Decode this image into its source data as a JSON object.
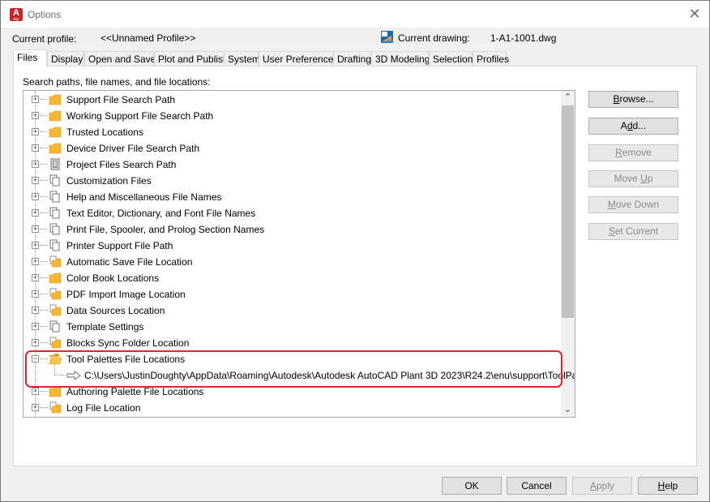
{
  "window": {
    "title": "Options",
    "app_icon_letter": "A",
    "app_icon_sub": "PID",
    "close_glyph": "✕"
  },
  "profile": {
    "current_profile_label": "Current profile:",
    "current_profile_value": "<<Unnamed Profile>>",
    "current_drawing_label": "Current drawing:",
    "current_drawing_value": "1-A1-1001.dwg"
  },
  "tabs": [
    {
      "label": "Files",
      "active": true
    },
    {
      "label": "Display"
    },
    {
      "label": "Open and Save"
    },
    {
      "label": "Plot and Publish"
    },
    {
      "label": "System"
    },
    {
      "label": "User Preferences"
    },
    {
      "label": "Drafting"
    },
    {
      "label": "3D Modeling"
    },
    {
      "label": "Selection"
    },
    {
      "label": "Profiles"
    }
  ],
  "files": {
    "search_label": "Search paths, file names, and file locations:",
    "tree": [
      {
        "label": "Support File Search Path",
        "icon": "folder-icon"
      },
      {
        "label": "Working Support File Search Path",
        "icon": "folder-icon"
      },
      {
        "label": "Trusted Locations",
        "icon": "folder-icon"
      },
      {
        "label": "Device Driver File Search Path",
        "icon": "folder-icon"
      },
      {
        "label": "Project Files Search Path",
        "icon": "project-file-icon"
      },
      {
        "label": "Customization Files",
        "icon": "files-icon"
      },
      {
        "label": "Help and Miscellaneous File Names",
        "icon": "files-icon"
      },
      {
        "label": "Text Editor, Dictionary, and Font File Names",
        "icon": "files-icon"
      },
      {
        "label": "Print File, Spooler, and Prolog Section Names",
        "icon": "files-icon"
      },
      {
        "label": "Printer Support File Path",
        "icon": "files-icon"
      },
      {
        "label": "Automatic Save File Location",
        "icon": "folder-file-icon"
      },
      {
        "label": "Color Book Locations",
        "icon": "folder-icon"
      },
      {
        "label": "PDF Import Image Location",
        "icon": "folder-file-icon"
      },
      {
        "label": "Data Sources Location",
        "icon": "folder-file-icon"
      },
      {
        "label": "Template Settings",
        "icon": "files-icon"
      },
      {
        "label": "Blocks Sync Folder Location",
        "icon": "folder-file-icon"
      },
      {
        "label": "Tool Palettes File Locations",
        "icon": "open-folder-icon",
        "expanded": true
      },
      {
        "label": "C:\\Users\\JustinDoughty\\AppData\\Roaming\\Autodesk\\Autodesk AutoCAD Plant 3D 2023\\R24.2\\enu\\support\\ToolPalette",
        "icon": "arrow-icon",
        "child": true
      },
      {
        "label": "Authoring Palette File Locations",
        "icon": "folder-icon"
      },
      {
        "label": "Log File Location",
        "icon": "folder-file-icon"
      }
    ],
    "expander_plus": "+",
    "expander_minus": "−",
    "scroll_up_glyph": "⌃",
    "scroll_down_glyph": "⌄"
  },
  "side_buttons": {
    "browse": "Browse...",
    "add": "Add...",
    "remove": "Remove",
    "move_up": "Move Up",
    "move_down": "Move Down",
    "set_current": "Set Current"
  },
  "bottom_buttons": {
    "ok": "OK",
    "cancel": "Cancel",
    "apply": "Apply",
    "help": "Help"
  },
  "colors": {
    "highlight": "#e2222f",
    "folder": "#f5b731",
    "app_red": "#c4262e"
  }
}
